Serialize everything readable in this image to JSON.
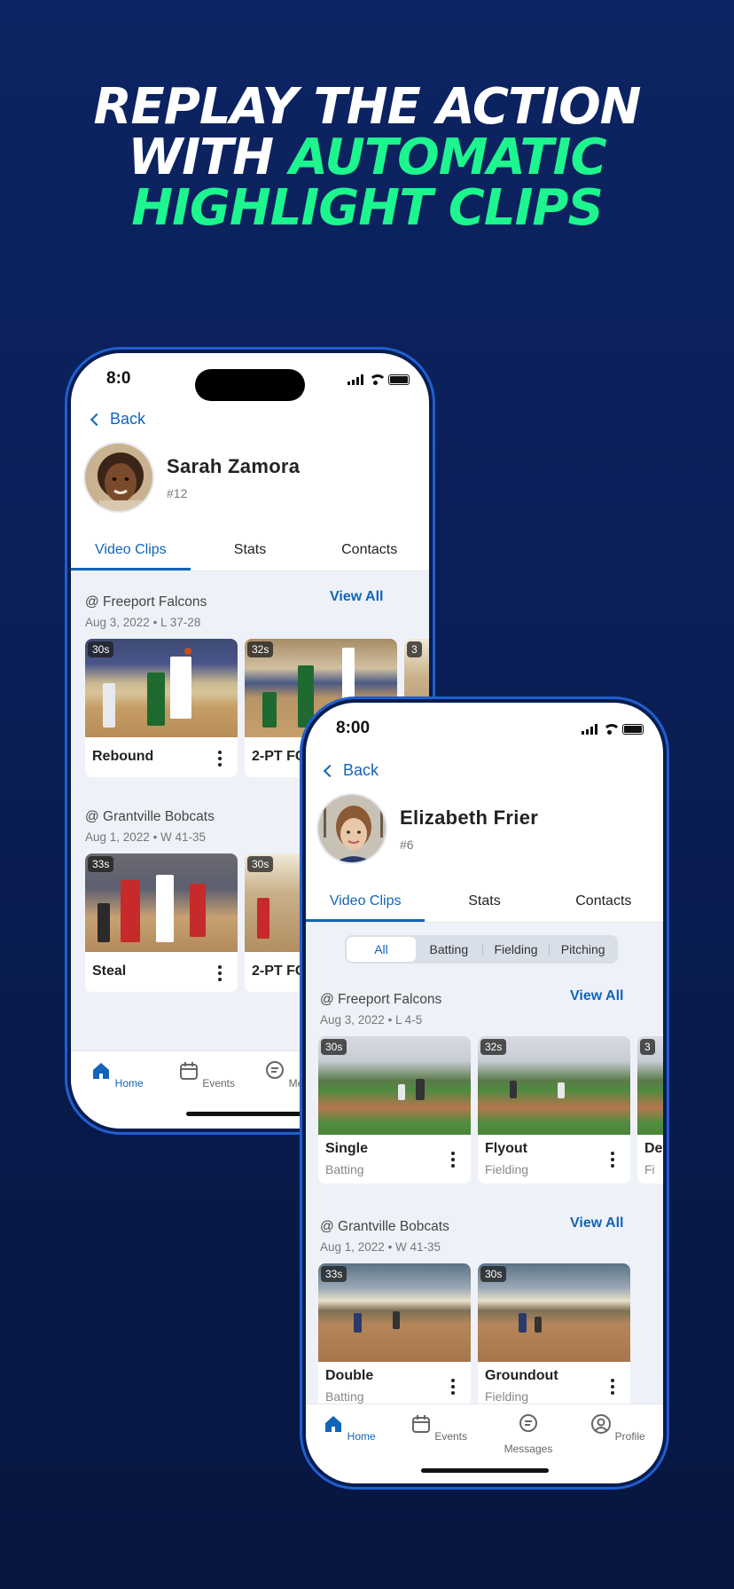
{
  "headline": {
    "line1": "REPLAY THE ACTION",
    "line2_white": "WITH ",
    "line2_green": "AUTOMATIC",
    "line3_green": "HIGHLIGHT CLIPS"
  },
  "colors": {
    "accent": "#1264b8",
    "headline_green": "#1df58f",
    "background": "#0b1f57"
  },
  "phone1": {
    "time": "8:0",
    "back": "Back",
    "player": {
      "name": "Sarah Zamora",
      "number": "#12"
    },
    "tabs": [
      "Video Clips",
      "Stats",
      "Contacts"
    ],
    "groups": [
      {
        "opponent": "@ Freeport Falcons",
        "info": "Aug 3, 2022 • L 37-28",
        "view_all": "View All",
        "clips": [
          {
            "duration": "30s",
            "label": "Rebound"
          },
          {
            "duration": "32s",
            "label": "2-PT FG"
          },
          {
            "duration": "3",
            "label": ""
          }
        ]
      },
      {
        "opponent": "@ Grantville Bobcats",
        "info": "Aug 1, 2022 • W 41-35",
        "clips": [
          {
            "duration": "33s",
            "label": "Steal"
          },
          {
            "duration": "30s",
            "label": "2-PT FG"
          }
        ]
      }
    ],
    "tabbar": [
      {
        "label": "Home",
        "icon": "home-icon"
      },
      {
        "label": "Events",
        "icon": "calendar-icon"
      },
      {
        "label": "Messag",
        "icon": "messages-icon"
      }
    ]
  },
  "phone2": {
    "time": "8:00",
    "back": "Back",
    "player": {
      "name": "Elizabeth Frier",
      "number": "#6"
    },
    "tabs": [
      "Video Clips",
      "Stats",
      "Contacts"
    ],
    "filters": [
      "All",
      "Batting",
      "Fielding",
      "Pitching"
    ],
    "groups": [
      {
        "opponent": "@ Freeport Falcons",
        "info": "Aug 3, 2022 • L 4-5",
        "view_all": "View All",
        "clips": [
          {
            "duration": "30s",
            "label": "Single",
            "sub": "Batting"
          },
          {
            "duration": "32s",
            "label": "Flyout",
            "sub": "Fielding"
          },
          {
            "duration": "3",
            "label": "De",
            "sub": "Fi"
          }
        ]
      },
      {
        "opponent": "@ Grantville Bobcats",
        "info": "Aug 1, 2022 • W 41-35",
        "view_all": "View All",
        "clips": [
          {
            "duration": "33s",
            "label": "Double",
            "sub": "Batting"
          },
          {
            "duration": "30s",
            "label": "Groundout",
            "sub": "Fielding"
          }
        ]
      }
    ],
    "tabbar": [
      {
        "label": "Home",
        "icon": "home-icon"
      },
      {
        "label": "Events",
        "icon": "calendar-icon"
      },
      {
        "label": "Messages",
        "icon": "messages-icon"
      },
      {
        "label": "Profile",
        "icon": "profile-icon"
      }
    ]
  }
}
